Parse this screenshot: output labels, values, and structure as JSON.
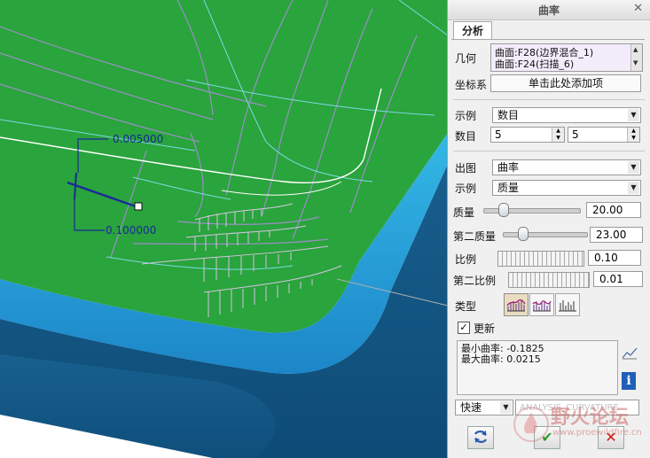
{
  "dialog": {
    "title": "曲率",
    "close_glyph": "✕",
    "tab_label": "分析",
    "geometry_label": "几何",
    "geometry_items": [
      "曲面:F28(边界混合_1)",
      "曲面:F24(扫描_6)"
    ],
    "coord_label": "坐标系",
    "coord_button": "单击此处添加项",
    "sample_label": "示例",
    "sample_value": "数目",
    "count_label": "数目",
    "count_values": [
      "5",
      "5"
    ],
    "output_label": "出图",
    "output_value": "曲率",
    "sample2_label": "示例",
    "sample2_value": "质量",
    "quality_label": "质量",
    "quality_value": "20.00",
    "quality_slider_fraction": 0.2,
    "quality2_label": "第二质量",
    "quality2_value": "23.00",
    "quality2_slider_fraction": 0.23,
    "scale_label": "比例",
    "scale_value": "0.10",
    "scale2_label": "第二比例",
    "scale2_value": "0.01",
    "type_label": "类型",
    "update_label": "更新",
    "update_checked": true,
    "result_lines": [
      "最小曲率: -0.1825",
      "最大曲率: 0.0215"
    ],
    "speed_value": "快速",
    "analysis_name": "ANALYSIS_CURVATURE",
    "ok_glyph": "✔",
    "cancel_glyph": "✕"
  },
  "viewport": {
    "dimension_labels": [
      "0.005000",
      "0.100000"
    ]
  },
  "watermark": {
    "text": "野火论坛",
    "url": "www.proewildfire.cn"
  },
  "colors": {
    "surface_green": "#2aa43c",
    "edge_cyan": "#27b1de",
    "wall_blue": "#1a6c9e",
    "curvature_comb": "#c9a8d6",
    "dim_blue": "#1a2a9a"
  }
}
